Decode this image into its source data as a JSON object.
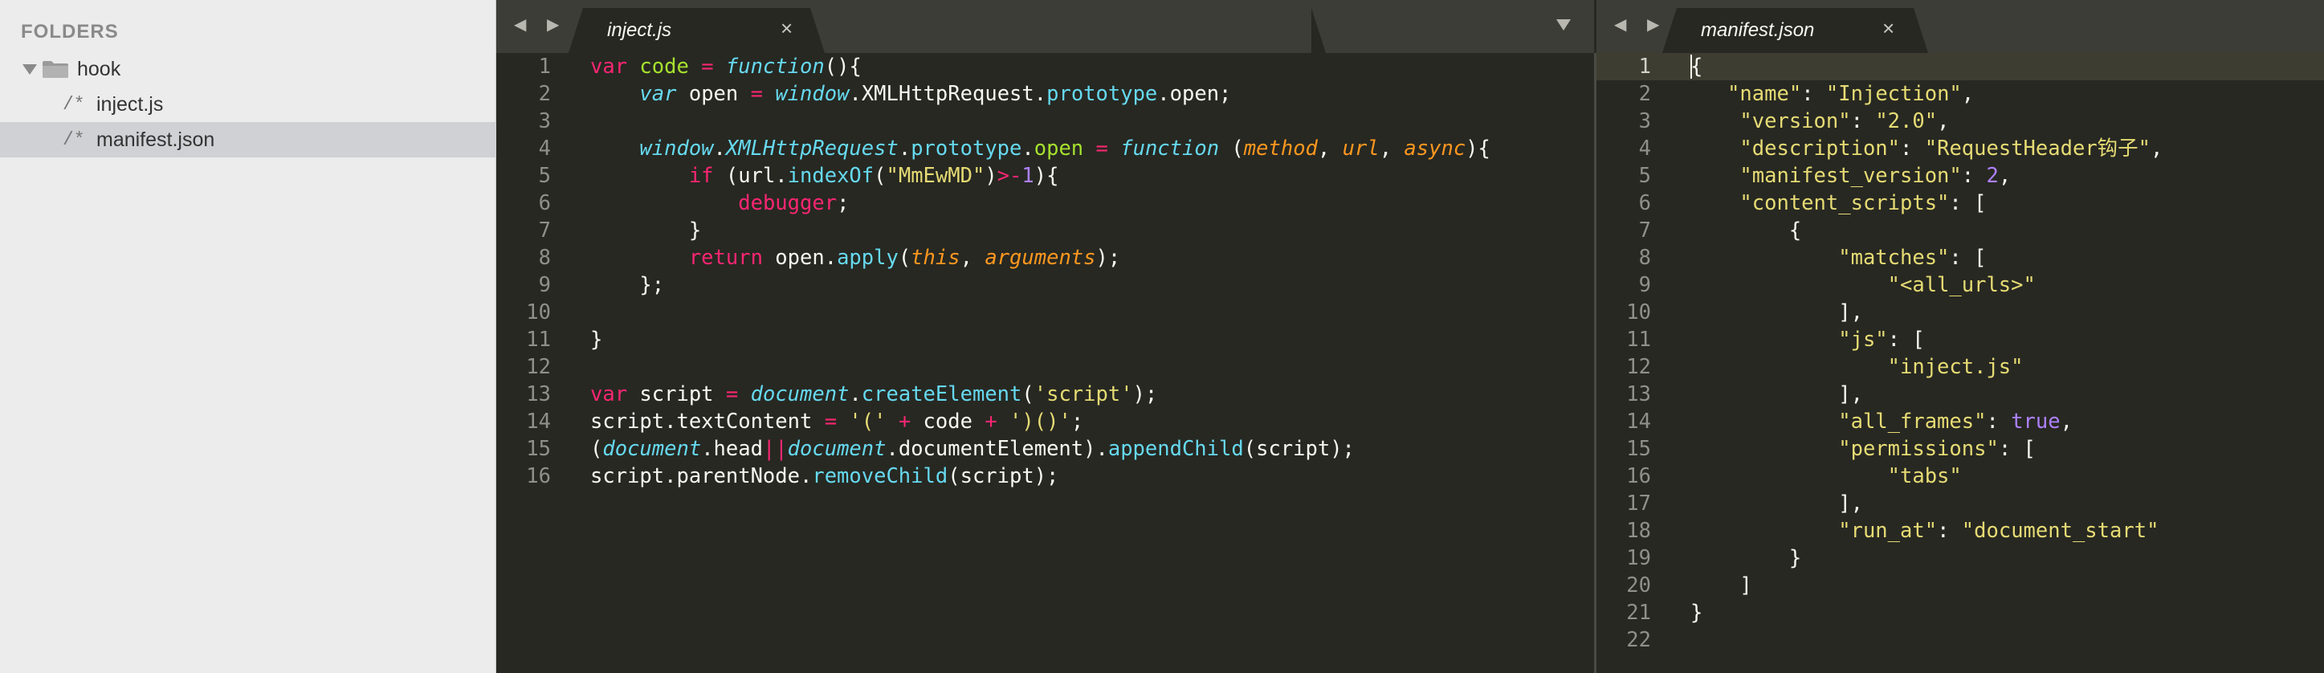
{
  "sidebar": {
    "heading": "FOLDERS",
    "folder": {
      "name": "hook",
      "icon": "folder-icon"
    },
    "files": [
      {
        "icon": "/*",
        "name": "inject.js",
        "selected": false
      },
      {
        "icon": "/*",
        "name": "manifest.json",
        "selected": true
      }
    ]
  },
  "left_pane": {
    "tab": {
      "label": "inject.js",
      "close": "×"
    },
    "nav": "◀ ▶",
    "lines": [
      [
        [
          "k",
          "var"
        ],
        [
          "w",
          " "
        ],
        [
          "f",
          "code"
        ],
        [
          "w",
          " "
        ],
        [
          "k",
          "="
        ],
        [
          "w",
          " "
        ],
        [
          "ci",
          "function"
        ],
        [
          "w",
          "(){"
        ]
      ],
      [
        [
          "w",
          "    "
        ],
        [
          "ci",
          "var"
        ],
        [
          "w",
          " open "
        ],
        [
          "k",
          "="
        ],
        [
          "w",
          " "
        ],
        [
          "ci",
          "window"
        ],
        [
          "w",
          "."
        ],
        [
          "w",
          "XMLHttpRequest"
        ],
        [
          "w",
          "."
        ],
        [
          "c",
          "prototype"
        ],
        [
          "w",
          ".open;"
        ]
      ],
      [],
      [
        [
          "w",
          "    "
        ],
        [
          "ci",
          "window"
        ],
        [
          "w",
          "."
        ],
        [
          "ci",
          "XMLHttpRequest"
        ],
        [
          "w",
          "."
        ],
        [
          "c",
          "prototype"
        ],
        [
          "w",
          "."
        ],
        [
          "f",
          "open"
        ],
        [
          "w",
          " "
        ],
        [
          "k",
          "="
        ],
        [
          "w",
          " "
        ],
        [
          "ci",
          "function"
        ],
        [
          "w",
          " ("
        ],
        [
          "p",
          "method"
        ],
        [
          "w",
          ", "
        ],
        [
          "p",
          "url"
        ],
        [
          "w",
          ", "
        ],
        [
          "p",
          "async"
        ],
        [
          "w",
          "){"
        ]
      ],
      [
        [
          "w",
          "        "
        ],
        [
          "k",
          "if"
        ],
        [
          "w",
          " (url."
        ],
        [
          "c",
          "indexOf"
        ],
        [
          "w",
          "("
        ],
        [
          "s",
          "\"MmEwMD\""
        ],
        [
          "w",
          ")"
        ],
        [
          "k",
          ">-"
        ],
        [
          "n",
          "1"
        ],
        [
          "w",
          "){"
        ]
      ],
      [
        [
          "w",
          "            "
        ],
        [
          "k",
          "debugger"
        ],
        [
          "w",
          ";"
        ]
      ],
      [
        [
          "w",
          "        }"
        ]
      ],
      [
        [
          "w",
          "        "
        ],
        [
          "k",
          "return"
        ],
        [
          "w",
          " open."
        ],
        [
          "c",
          "apply"
        ],
        [
          "w",
          "("
        ],
        [
          "p",
          "this"
        ],
        [
          "w",
          ", "
        ],
        [
          "p",
          "arguments"
        ],
        [
          "w",
          ");"
        ]
      ],
      [
        [
          "w",
          "    };"
        ]
      ],
      [],
      [
        [
          "w",
          "}"
        ]
      ],
      [],
      [
        [
          "k",
          "var"
        ],
        [
          "w",
          " script "
        ],
        [
          "k",
          "="
        ],
        [
          "w",
          " "
        ],
        [
          "ci",
          "document"
        ],
        [
          "w",
          "."
        ],
        [
          "c",
          "createElement"
        ],
        [
          "w",
          "("
        ],
        [
          "s",
          "'script'"
        ],
        [
          "w",
          ");"
        ]
      ],
      [
        [
          "w",
          "script.textContent "
        ],
        [
          "k",
          "="
        ],
        [
          "w",
          " "
        ],
        [
          "s",
          "'('"
        ],
        [
          "w",
          " "
        ],
        [
          "k",
          "+"
        ],
        [
          "w",
          " code "
        ],
        [
          "k",
          "+"
        ],
        [
          "w",
          " "
        ],
        [
          "s",
          "')()'"
        ],
        [
          "w",
          ";"
        ]
      ],
      [
        [
          "w",
          "("
        ],
        [
          "ci",
          "document"
        ],
        [
          "w",
          ".head"
        ],
        [
          "k",
          "||"
        ],
        [
          "ci",
          "document"
        ],
        [
          "w",
          ".documentElement)."
        ],
        [
          "c",
          "appendChild"
        ],
        [
          "w",
          "(script);"
        ]
      ],
      [
        [
          "w",
          "script.parentNode."
        ],
        [
          "c",
          "removeChild"
        ],
        [
          "w",
          "(script);"
        ]
      ]
    ]
  },
  "right_pane": {
    "tab": {
      "label": "manifest.json",
      "close": "×"
    },
    "nav": "◀ ▶",
    "lines": [
      [
        [
          "w",
          "{"
        ]
      ],
      [
        [
          "w",
          "   "
        ],
        [
          "s",
          "\"name\""
        ],
        [
          "w",
          ": "
        ],
        [
          "s",
          "\"Injection\""
        ],
        [
          "w",
          ","
        ]
      ],
      [
        [
          "w",
          "    "
        ],
        [
          "s",
          "\"version\""
        ],
        [
          "w",
          ": "
        ],
        [
          "s",
          "\"2.0\""
        ],
        [
          "w",
          ","
        ]
      ],
      [
        [
          "w",
          "    "
        ],
        [
          "s",
          "\"description\""
        ],
        [
          "w",
          ": "
        ],
        [
          "s",
          "\"RequestHeader钩子\""
        ],
        [
          "w",
          ","
        ]
      ],
      [
        [
          "w",
          "    "
        ],
        [
          "s",
          "\"manifest_version\""
        ],
        [
          "w",
          ": "
        ],
        [
          "n",
          "2"
        ],
        [
          "w",
          ","
        ]
      ],
      [
        [
          "w",
          "    "
        ],
        [
          "s",
          "\"content_scripts\""
        ],
        [
          "w",
          ": ["
        ]
      ],
      [
        [
          "w",
          "        {"
        ]
      ],
      [
        [
          "w",
          "            "
        ],
        [
          "s",
          "\"matches\""
        ],
        [
          "w",
          ": ["
        ]
      ],
      [
        [
          "w",
          "                "
        ],
        [
          "s",
          "\"<all_urls>\""
        ]
      ],
      [
        [
          "w",
          "            ],"
        ]
      ],
      [
        [
          "w",
          "            "
        ],
        [
          "s",
          "\"js\""
        ],
        [
          "w",
          ": ["
        ]
      ],
      [
        [
          "w",
          "                "
        ],
        [
          "s",
          "\"inject.js\""
        ]
      ],
      [
        [
          "w",
          "            ],"
        ]
      ],
      [
        [
          "w",
          "            "
        ],
        [
          "s",
          "\"all_frames\""
        ],
        [
          "w",
          ": "
        ],
        [
          "n",
          "true"
        ],
        [
          "w",
          ","
        ]
      ],
      [
        [
          "w",
          "            "
        ],
        [
          "s",
          "\"permissions\""
        ],
        [
          "w",
          ": ["
        ]
      ],
      [
        [
          "w",
          "                "
        ],
        [
          "s",
          "\"tabs\""
        ]
      ],
      [
        [
          "w",
          "            ],"
        ]
      ],
      [
        [
          "w",
          "            "
        ],
        [
          "s",
          "\"run_at\""
        ],
        [
          "w",
          ": "
        ],
        [
          "s",
          "\"document_start\""
        ]
      ],
      [
        [
          "w",
          "        }"
        ]
      ],
      [
        [
          "w",
          "    ]"
        ]
      ],
      [
        [
          "w",
          "}"
        ]
      ],
      []
    ]
  },
  "colors": {
    "bg": "#272822",
    "keyword": "#f92672",
    "string": "#e6db74",
    "number": "#ae81ff",
    "function_name": "#a6e22e",
    "support": "#66d9ef",
    "param": "#fd971f"
  }
}
